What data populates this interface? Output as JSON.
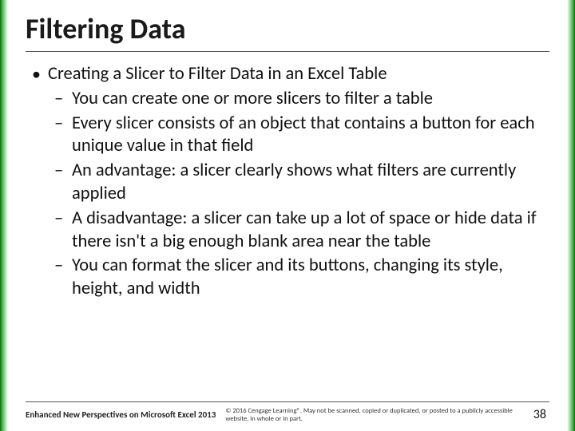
{
  "title": "Filtering Data",
  "bullet1": "Creating a Slicer to Filter Data in an Excel Table",
  "sub": {
    "a": "You can create one or more slicers to filter a table",
    "b": "Every slicer consists of an object that contains a button for each unique value in that field",
    "c": "An advantage: a slicer clearly shows what filters are currently applied",
    "d": "A disadvantage: a slicer can take up a lot of space or hide data if there isn't a big enough blank area near the table",
    "e": "You can format the slicer and its buttons, changing its style, height, and width"
  },
  "footer": {
    "left": "Enhanced New Perspectives on Microsoft Excel 2013",
    "center": "© 2016 Cengage Learning®. May not be scanned, copied or duplicated, or posted to a publicly accessible website, in whole or in part.",
    "page": "38"
  }
}
